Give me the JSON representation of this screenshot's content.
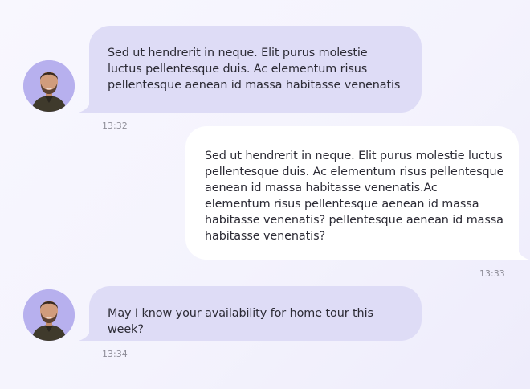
{
  "messages": [
    {
      "direction": "incoming",
      "text": "Sed ut hendrerit in neque. Elit purus molestie luctus pellentesque duis. Ac elementum risus pellentesque aenean id massa habitasse venenatis",
      "time": "13:32"
    },
    {
      "direction": "outgoing",
      "text": "Sed ut hendrerit in neque. Elit purus molestie luctus pellentesque duis. Ac elementum risus pellentesque aenean id massa habitasse venenatis.Ac elementum risus pellentesque aenean id massa habitasse venenatis? pellentesque aenean id massa habitasse venenatis?",
      "time": "13:33"
    },
    {
      "direction": "incoming",
      "text": "May I know your availability for home tour this week?",
      "time": "13:34"
    }
  ],
  "colors": {
    "incoming_bubble": "#dedcf6",
    "outgoing_bubble": "#ffffff",
    "avatar_background": "#b7b0ee",
    "timestamp": "#8d8c97"
  },
  "icons": {
    "avatar": "contact-avatar-photo"
  }
}
